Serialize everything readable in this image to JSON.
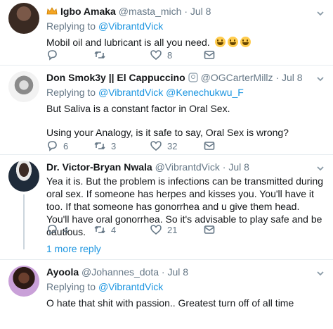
{
  "tweets": [
    {
      "name": "Igbo Amaka",
      "handle": "@masta_mich",
      "dot": "·",
      "time": "Jul 8",
      "replying_prefix": "Replying to ",
      "replying_to": "@VibrantdVick",
      "text": "Mobil oil and lubricant is all you need.",
      "retweets": "",
      "likes": "8",
      "replies": ""
    },
    {
      "name": "Don Smok3y || El Cappuccino",
      "handle": "@OGCarterMillz",
      "dot": "·",
      "time": "Jul 8",
      "replying_prefix": "Replying to ",
      "replying_to": "@VibrantdVick",
      "replying_to_2": "@Kenechukwu_F",
      "text_1": "But Saliva is a constant factor in Oral Sex.",
      "text_2": "Using your Analogy, is it safe to say, Oral Sex is wrong?",
      "replies": "6",
      "retweets": "3",
      "likes": "32"
    },
    {
      "name": "Dr. Victor-Bryan Nwala",
      "handle": "@VibrantdVick",
      "dot": "·",
      "time": "Jul 8",
      "text": "Yea it is. But  the problem is infections can be transmitted during oral sex. If someone has herpes and kisses you. You'll have it too. If that someone has gonorrhea and u give them head. You'll have oral gonorrhea.  So it's advisable to play safe and be cautious.",
      "replies": "4",
      "retweets": "4",
      "likes": "21"
    },
    {
      "name": "Ayoola",
      "handle": "@Johannes_dota",
      "dot": "·",
      "time": "Jul 8",
      "replying_prefix": "Replying to ",
      "replying_to": "@VibrantdVick",
      "text": "O hate that shit with passion.. Greatest turn off of all time"
    }
  ],
  "more_reply": "1 more reply",
  "colors": {
    "link": "#1b95e0",
    "muted": "#657786",
    "divider": "#e6ecf0"
  },
  "icons": [
    "reply-icon",
    "retweet-icon",
    "like-icon",
    "dm-icon",
    "chevron-down-icon",
    "crown-icon",
    "verified-badge-icon",
    "emoji-icon"
  ]
}
